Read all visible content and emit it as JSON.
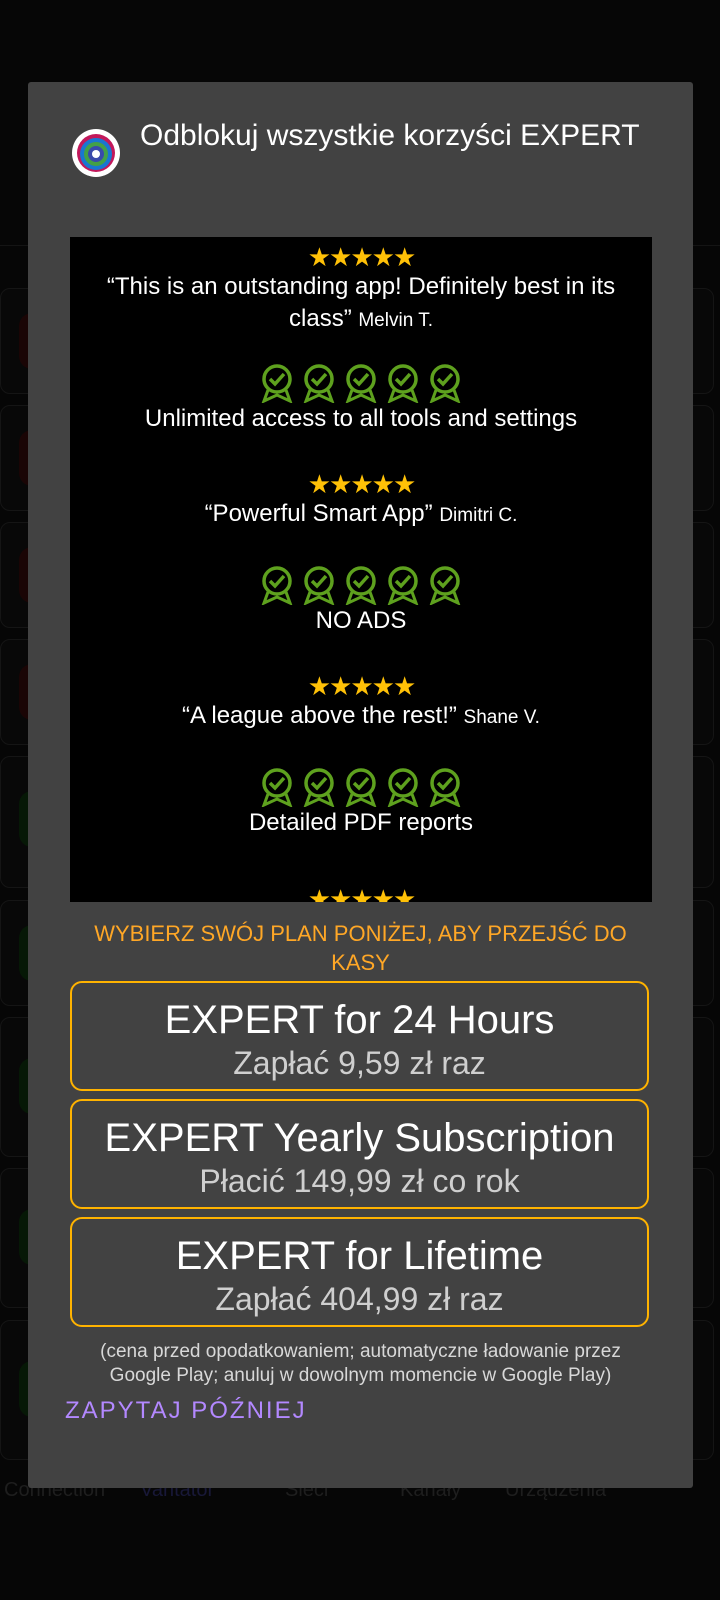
{
  "background_nav": {
    "items": [
      {
        "label": "Connection",
        "active": false
      },
      {
        "label": "Vantator",
        "active": true
      },
      {
        "label": "Sieci",
        "active": false
      },
      {
        "label": "Kanały",
        "active": false
      },
      {
        "label": "Urządzenia",
        "active": false
      }
    ]
  },
  "dialog": {
    "title": "Odblokuj wszystkie korzyści EXPERT",
    "icon": "app-logo-icon",
    "promo": {
      "stars": "★★★★★",
      "reviews": [
        {
          "quote": "“This is an outstanding app! Definitely best in its class”",
          "author": "Melvin T."
        },
        {
          "quote": "“Powerful Smart App”",
          "author": "Dimitri C."
        },
        {
          "quote": "“A league above the rest!”",
          "author": "Shane  V."
        }
      ],
      "features": [
        "Unlimited access to all tools and settings",
        "NO ADS",
        "Detailed PDF reports"
      ]
    },
    "choose_text": "WYBIERZ SWÓJ PLAN PONIŻEJ, ABY PRZEJŚĆ DO KASY",
    "plans": [
      {
        "title": "EXPERT for 24 Hours",
        "price": "Zapłać 9,59 zł raz"
      },
      {
        "title": "EXPERT Yearly Subscription",
        "price": "Płacić 149,99 zł co rok"
      },
      {
        "title": "EXPERT for Lifetime",
        "price": "Zapłać 404,99 zł raz"
      }
    ],
    "footnote": "(cena przed opodatkowaniem; automatyczne ładowanie przez Google Play; anuluj w dowolnym momencie w Google Play)",
    "later_button": "ZAPYTAJ PÓŹNIEJ"
  },
  "colors": {
    "accent_orange": "#ffa726",
    "plan_border": "#ffb300",
    "later_purple": "#b388ff",
    "badge_green": "#5ea11e",
    "star_yellow": "#ffc107"
  }
}
